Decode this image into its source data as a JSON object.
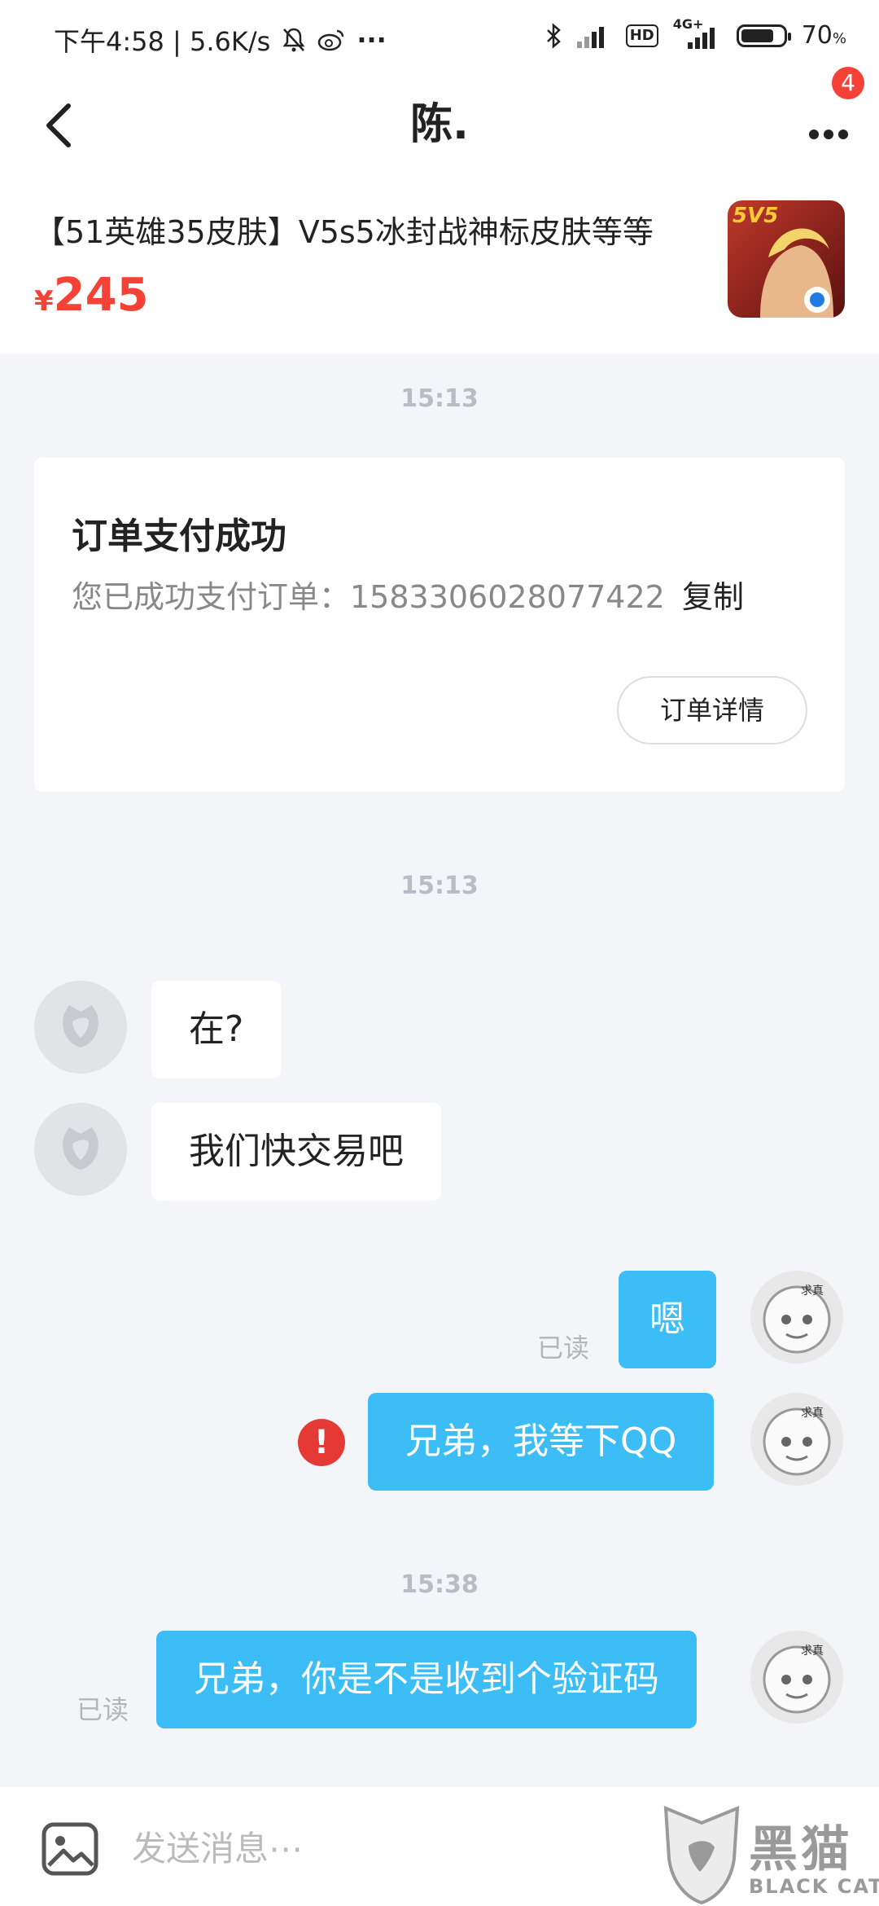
{
  "status_bar": {
    "left_text": "下午4:58 | 5.6K/s",
    "dots": "···",
    "network": "4G+",
    "hd": "HD",
    "battery": "70",
    "battery_unit": "%"
  },
  "nav": {
    "title": "陈.",
    "badge_count": "4"
  },
  "product": {
    "title": "【51英雄35皮肤】V5s5冰封战神标皮肤等等",
    "currency": "¥",
    "price": "245",
    "thumb_text": "5V5"
  },
  "timestamps": [
    "15:13",
    "15:13",
    "15:38"
  ],
  "order_card": {
    "title": "订单支付成功",
    "description": "您已成功支付订单：1583306028077422",
    "copy_label": "复制",
    "detail_button": "订单详情"
  },
  "messages": {
    "in_1": "在?",
    "in_2": "我们快交易吧",
    "out_1": "嗯",
    "out_2": "兄弟，我等下QQ",
    "out_3": "兄弟，你是不是收到个验证码",
    "read_label": "已读",
    "error_mark": "!",
    "self_avatar_tag": "求真"
  },
  "input": {
    "placeholder": "发送消息⋯"
  },
  "watermark": {
    "cn": "黑猫",
    "en": "BLACK CAT"
  },
  "colors": {
    "accent_blue": "#3dbdf5",
    "price_red": "#f44336",
    "badge_red": "#f44336",
    "background": "#f4f5f9"
  }
}
